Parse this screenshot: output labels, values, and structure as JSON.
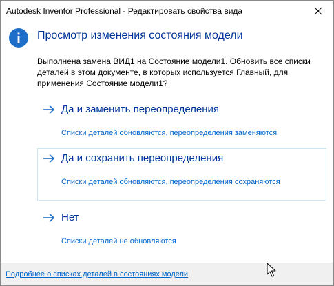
{
  "window": {
    "title": "Autodesk Inventor Professional - Редактировать свойства вида"
  },
  "dialog": {
    "main_instruction": "Просмотр изменения состояния модели",
    "content": "Выполнена замена ВИД1 на Состояние модели1. Обновить все списки деталей в этом документе, в которых используется Главный, для применения Состояние модели1?",
    "icon": "info-icon"
  },
  "options": [
    {
      "title": "Да и заменить переопределения",
      "note": "Списки деталей обновляются, переопределения заменяются",
      "icon": "arrow-right-icon"
    },
    {
      "title": "Да и сохранить переопределения",
      "note": "Списки деталей обновляются, переопределения сохраняются",
      "icon": "arrow-right-icon",
      "hovered": true
    },
    {
      "title": "Нет",
      "note": "Списки деталей не обновляются",
      "icon": "arrow-right-icon"
    }
  ],
  "footer": {
    "link": "Подробнее о списках деталей в состояниях модели"
  },
  "colors": {
    "instruction": "#003399",
    "link": "#0066cc",
    "info_icon_bg": "#1e6fc9",
    "hover_border": "#cde4f3",
    "footer_bg": "#f0f0f0"
  }
}
